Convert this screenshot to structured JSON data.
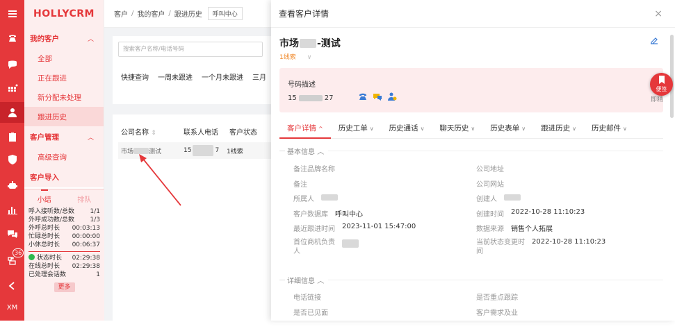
{
  "app": {
    "brand": "HOLLYCRM",
    "rail_bottom_label": "XM",
    "rail_badge": "36"
  },
  "nav": {
    "my_customers": "我的客户",
    "my_items": [
      "全部",
      "正在跟进",
      "新分配未处理",
      "跟进历史"
    ],
    "customer_mgmt": "客户管理",
    "mgmt_items": [
      "高级查询"
    ],
    "customer_import": "客户导入"
  },
  "summary": {
    "tab_active": "小结",
    "tab_other": "排队",
    "rows_a": [
      {
        "k": "呼入接听数/总数",
        "v": "1/1"
      },
      {
        "k": "外呼成功数/总数",
        "v": "1/3"
      },
      {
        "k": "外呼总时长",
        "v": "00:03:13"
      },
      {
        "k": "忙碌总时长",
        "v": "00:00:00"
      },
      {
        "k": "小休总时长",
        "v": "00:06:37"
      }
    ],
    "rows_b": [
      {
        "k": "状态时长",
        "v": "02:29:38"
      },
      {
        "k": "在线总时长",
        "v": "02:29:38"
      },
      {
        "k": "已处理会话数",
        "v": "1"
      }
    ],
    "more": "更多"
  },
  "breadcrumb": {
    "items": [
      "客户",
      "我的客户",
      "跟进历史"
    ],
    "sep": "/",
    "chip": "呼叫中心"
  },
  "search": {
    "placeholder": "搜索客户名称/电话号码"
  },
  "quick_filters": [
    "快捷查询",
    "一周未跟进",
    "一个月未跟进",
    "三月"
  ],
  "table": {
    "headers": [
      "公司名称",
      "联系人电话",
      "客户状态"
    ],
    "sort_glyph": "⇕",
    "row": {
      "company_a": "市场",
      "company_b": "测试",
      "phone_a": "15",
      "phone_b": "7",
      "status": "1线索"
    }
  },
  "drawer": {
    "title": "查看客户详情",
    "close": "×",
    "customer_name_a": "市场",
    "customer_name_b": "-测试",
    "lead_tag": "1线索",
    "phone_desc_label": "号码描述",
    "phone_a": "15",
    "phone_b": "27",
    "fold": "即精",
    "sticky_label": "便签",
    "tabs": [
      "客户详情",
      "历史工单",
      "历史通话",
      "聊天历史",
      "历史表单",
      "跟进历史",
      "历史邮件"
    ],
    "tab_active_chev": "^",
    "tab_chev": "∨",
    "basic_info": "基本信息",
    "detail_info": "详细信息",
    "fields_left": [
      {
        "k": "备注品牌名称",
        "v": ""
      },
      {
        "k": "备注",
        "v": ""
      },
      {
        "k": "所属人",
        "v": ""
      },
      {
        "k": "客户数据库",
        "v": "呼叫中心"
      },
      {
        "k": "最近跟进时间",
        "v": "2023-11-01 15:47:00"
      },
      {
        "k": "首位商机负责人",
        "v": ""
      }
    ],
    "fields_right": [
      {
        "k": "公司地址",
        "v": ""
      },
      {
        "k": "公司网站",
        "v": ""
      },
      {
        "k": "创建人",
        "v": ""
      },
      {
        "k": "创建时间",
        "v": "2022-10-28 11:10:23"
      },
      {
        "k": "数据来源",
        "v": "销售个人拓展"
      },
      {
        "k": "当前状态变更时间",
        "v": "2022-10-28 11:10:23"
      }
    ],
    "detail_left": [
      "电话链接",
      "是否已见面"
    ],
    "detail_right": [
      "是否重点跟踪",
      "客户需求及业"
    ]
  },
  "colors": {
    "accent": "#e5383b",
    "accent_light": "#fdeeee",
    "lead_orange": "#f08a2c",
    "online_green": "#2db84d"
  }
}
